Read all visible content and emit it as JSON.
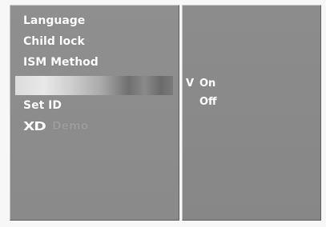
{
  "menu": {
    "items": [
      {
        "label": "Language"
      },
      {
        "label": "Child lock"
      },
      {
        "label": "ISM Method"
      },
      {
        "label": ""
      },
      {
        "label": "Set ID"
      },
      {
        "label": "Demo",
        "logo": "XD"
      }
    ]
  },
  "submenu": {
    "check_mark": "V",
    "options": [
      {
        "label": "On",
        "selected": true
      },
      {
        "label": "Off",
        "selected": false
      }
    ]
  },
  "colors": {
    "panel": "#8e8e8e",
    "text": "#ffffff",
    "dim_text": "#9d9d9d"
  }
}
